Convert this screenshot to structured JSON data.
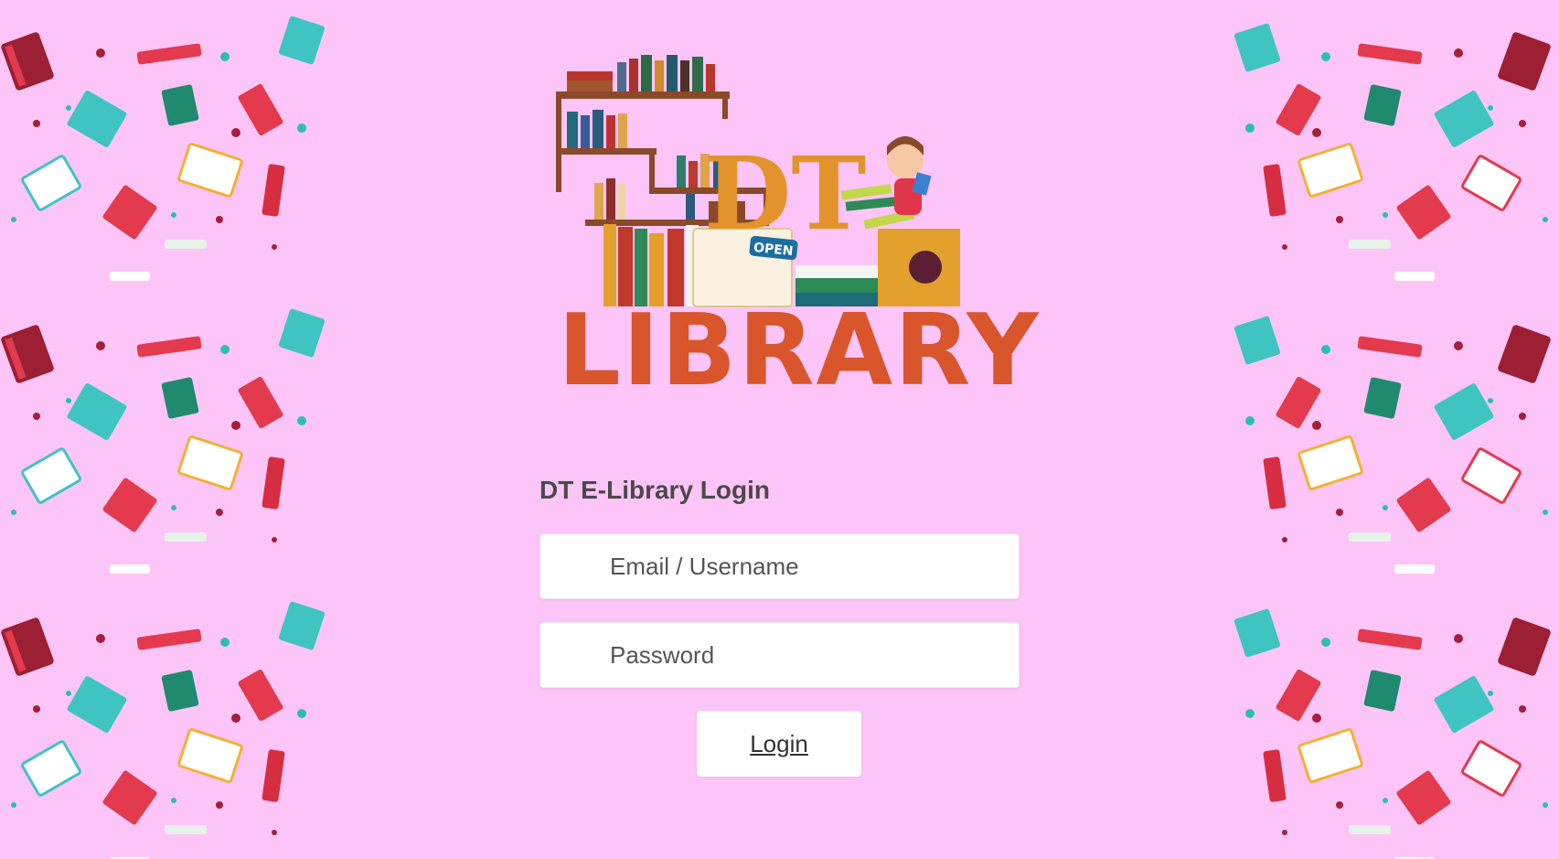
{
  "logo": {
    "top_text": "DT",
    "bottom_text": "LIBRARY",
    "sign_text": "OPEN"
  },
  "login": {
    "title": "DT E-Library Login",
    "email_placeholder": "Email / Username",
    "password_placeholder": "Password",
    "button_label": "Login"
  },
  "colors": {
    "background": "#fdc5f7",
    "book_red": "#e33a4d",
    "book_teal": "#3fc4c1",
    "book_maroon": "#9c1f34",
    "book_green": "#1f8a6e",
    "dot_teal": "#2bbfb4",
    "dot_maroon": "#a51e3a"
  }
}
